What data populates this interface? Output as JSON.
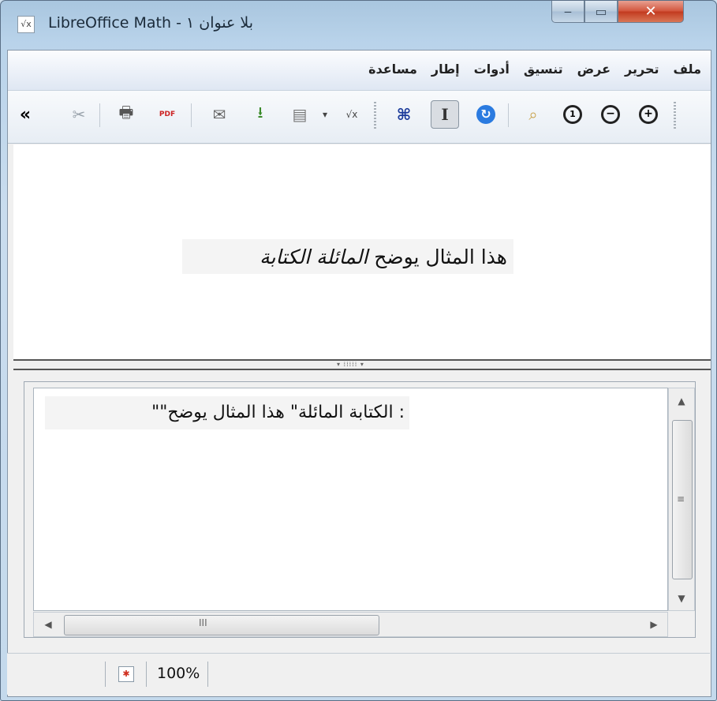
{
  "window": {
    "title": "بلا عنوان ١ - LibreOffice Math",
    "title_icon": "formula-icon",
    "buttons": {
      "minimize": "‒",
      "maximize": "▭",
      "close": "✕"
    }
  },
  "menu": {
    "items": [
      "ملف",
      "تحرير",
      "عرض",
      "تنسيق",
      "أدوات",
      "إطار",
      "مساعدة"
    ]
  },
  "toolbar": {
    "overflow": "«",
    "icons": [
      "cut-icon",
      "print-icon",
      "export-pdf-icon",
      "email-icon",
      "save-icon",
      "open-icon",
      "dropdown-arrow-icon",
      "new-formula-icon",
      "symbols-icon",
      "formula-cursor-icon",
      "update-icon",
      "show-all-icon",
      "zoom-100-icon",
      "zoom-out-icon",
      "zoom-in-icon"
    ],
    "glyphs": {
      "overflow": "«",
      "cut": "✂",
      "print": "🖶",
      "pdf": "PDF",
      "email": "✉",
      "save": "⭳",
      "open": "▤",
      "dropdown": "▾",
      "new": "√x",
      "symbols": "⌘",
      "cursor": "I",
      "update": "↻",
      "show_all": "⌕",
      "zoom_100": "1",
      "zoom_out": "−",
      "zoom_in": "+"
    }
  },
  "preview": {
    "normal_text": "هذا المثال يوضح",
    "italic_text": "المائلة الكتابة"
  },
  "editor": {
    "command_text": ": الكتابة المائلة\" هذا المثال يوضح\"\""
  },
  "scrollbars": {
    "up": "▲",
    "down": "▼",
    "left": "◀",
    "right": "▶",
    "v_grip": "≡",
    "h_grip": "III"
  },
  "status": {
    "zoom": "100%"
  }
}
